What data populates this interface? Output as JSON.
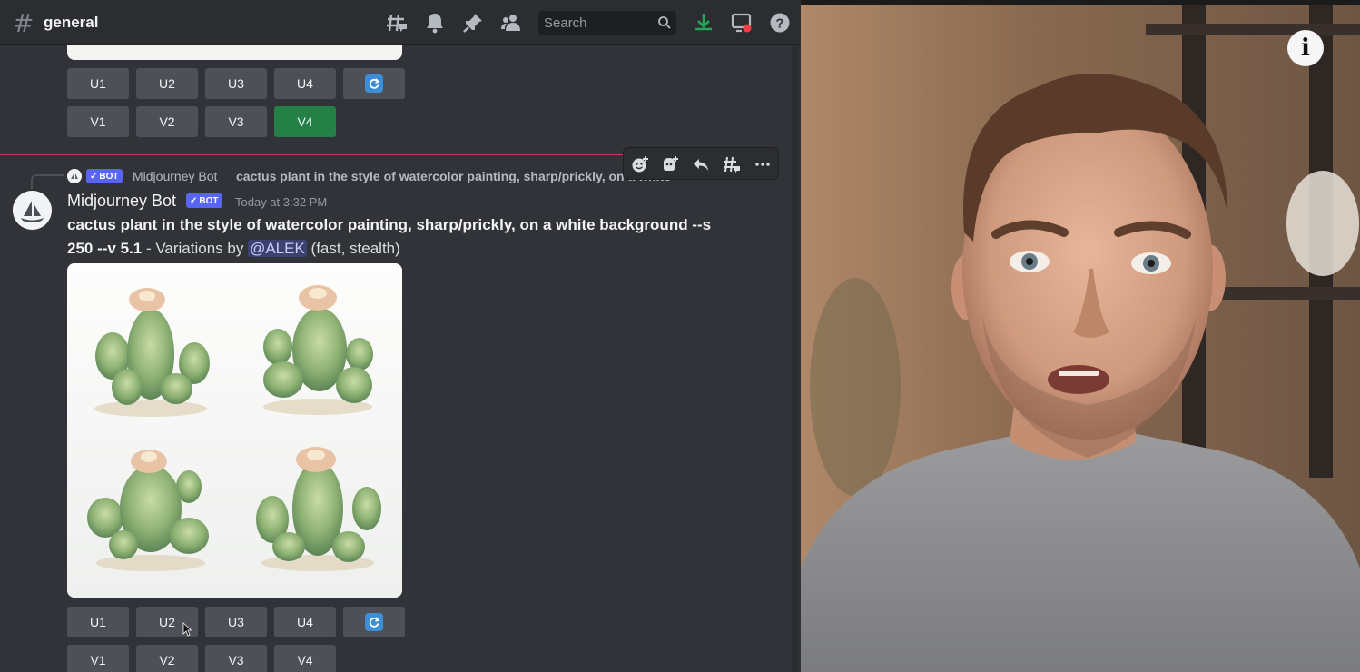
{
  "discord": {
    "channel": {
      "icon": "hashtag-icon",
      "name": "general"
    },
    "toolbar": {
      "icons": [
        "threads-icon",
        "bell-icon",
        "pin-icon",
        "members-icon",
        "download-icon",
        "inbox-icon",
        "help-icon"
      ],
      "search_placeholder": "Search"
    },
    "previous_buttons": {
      "upscale": [
        "U1",
        "U2",
        "U3",
        "U4"
      ],
      "variation": [
        "V1",
        "V2",
        "V3",
        "V4"
      ],
      "active_variation": "V4"
    },
    "reply_preview": {
      "bot_tag": "BOT",
      "author": "Midjourney Bot",
      "text": "cactus plant in the style of watercolor painting, sharp/prickly, on a white"
    },
    "hover_toolbar": [
      "add-reaction-icon",
      "app-reaction-icon",
      "reply-icon",
      "create-thread-icon",
      "more-icon"
    ],
    "message": {
      "author": "Midjourney Bot",
      "bot_tag": "BOT",
      "timestamp": "Today at 3:32 PM",
      "prompt_line1": "cactus plant in the style of watercolor painting, sharp/prickly, on a white background --s",
      "prompt_line2": "250 --v 5.1",
      "suffix_pre": " - Variations by ",
      "mention": "@ALEK",
      "suffix_post": " (fast, stealth)"
    },
    "buttons": {
      "upscale": [
        "U1",
        "U2",
        "U3",
        "U4"
      ],
      "variation": [
        "V1",
        "V2",
        "V3",
        "V4"
      ]
    }
  },
  "video": {
    "overlay_icon": "info-icon",
    "overlay_text": "i"
  },
  "colors": {
    "discord_bg": "#313338",
    "topbar_bg": "#2b2d31",
    "button_bg": "#4e5058",
    "active_green": "#248046",
    "blurple": "#5865f2"
  }
}
